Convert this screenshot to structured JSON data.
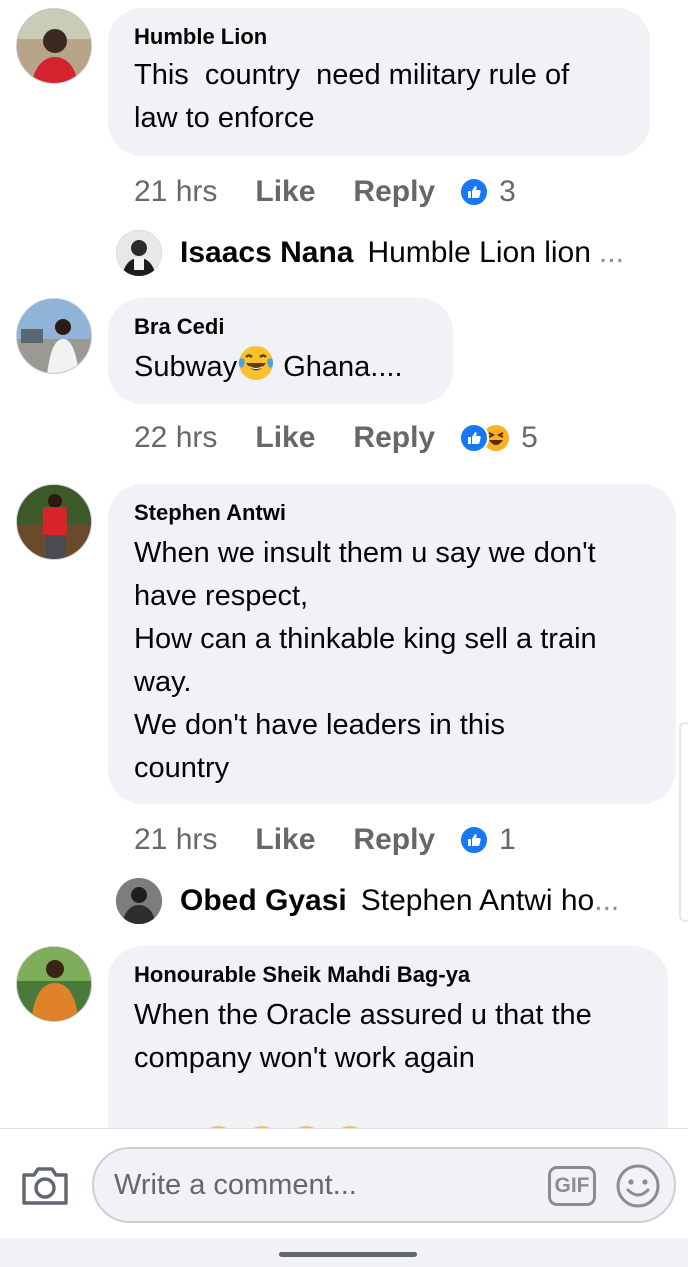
{
  "comments": [
    {
      "author": "Humble Lion",
      "lines": [
        "This  country  need military rule of",
        "law to enforce"
      ],
      "time": "21 hrs",
      "like_label": "Like",
      "reply_label": "Reply",
      "reaction_count": "3",
      "reply": {
        "name": "Isaacs Nana",
        "text": "Humble Lion lion",
        "ellipsis": "..."
      }
    },
    {
      "author": "Bra Cedi",
      "text_before_emoji": "Subway",
      "text_after_emoji": " Ghana....",
      "time": "22 hrs",
      "like_label": "Like",
      "reply_label": "Reply",
      "reaction_count": "5"
    },
    {
      "author": "Stephen Antwi",
      "lines": [
        "When we insult them u say we don't",
        "have respect,",
        "How can a thinkable king sell a train",
        "way.",
        "We don't have leaders in this",
        "country"
      ],
      "time": "21 hrs",
      "like_label": "Like",
      "reply_label": "Reply",
      "reaction_count": "1",
      "reply": {
        "name": "Obed Gyasi",
        "text": "Stephen Antwi ho",
        "ellipsis": "..."
      }
    },
    {
      "author": "Honourable Sheik Mahdi Bag-ya",
      "lines": [
        "When the Oracle assured u that the",
        "company won't work again"
      ],
      "emoji_count": 4
    }
  ],
  "composer": {
    "placeholder": "Write a comment...",
    "gif_label": "GIF"
  },
  "icons": {
    "camera": "camera-icon",
    "gif": "gif-icon",
    "emoji": "smiley-icon",
    "like": "like-reaction-icon",
    "haha": "haha-reaction-icon"
  },
  "colors": {
    "like_blue": "#1877f2",
    "bubble_bg": "#f0f2f5",
    "secondary_text": "#65676b"
  }
}
